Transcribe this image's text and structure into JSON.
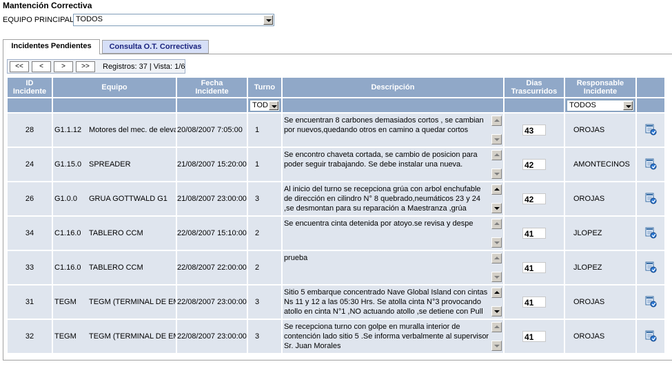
{
  "header": {
    "title": "Mantención Correctiva"
  },
  "filter": {
    "label": "EQUIPO PRINCIPAL :",
    "value": "TODOS"
  },
  "tabs": [
    {
      "label": "Incidentes Pendientes"
    },
    {
      "label": "Consulta O.T. Correctivas"
    }
  ],
  "pager": {
    "first": "<<",
    "prev": "<",
    "next": ">",
    "last": ">>",
    "status": "Registros: 37 | Vista: 1/6"
  },
  "columns": {
    "id": [
      "ID",
      "Incidente"
    ],
    "equipo": "Equipo",
    "fecha": [
      "Fecha",
      "Incidente"
    ],
    "turno": "Turno",
    "descripcion": "Descripción",
    "dias": [
      "Dias",
      "Trascurridos"
    ],
    "responsable": [
      "Responsable",
      "Incidente"
    ]
  },
  "filters": {
    "turno": "TOD",
    "responsable": "TODOS"
  },
  "rows": [
    {
      "id": "28",
      "code": "G1.1.12",
      "name": "Motores del mec. de eleva",
      "fecha": "20/08/2007 7:05:00",
      "turno": "1",
      "desc": "Se encuentran 8 carbones demasiados cortos , se cambian por nuevos,quedando otros en camino a quedar cortos",
      "dias": "43",
      "resp": "OROJAS"
    },
    {
      "id": "24",
      "code": "G1.15.0",
      "name": "SPREADER",
      "fecha": "21/08/2007 15:20:00",
      "turno": "1",
      "desc": "Se encontro chaveta cortada, se cambio de posicion para poder seguir trabajando. Se debe instalar una nueva.",
      "dias": "42",
      "resp": "AMONTECINOS"
    },
    {
      "id": "26",
      "code": "G1.0.0",
      "name": "GRUA GOTTWALD G1",
      "fecha": "21/08/2007 23:00:00",
      "turno": "3",
      "desc": "Al inicio del turno se recepciona grúa con arbol enchufable de dirección en cilindro N° 8 quebrado,neumáticos 23 y 24 ,se desmontan  para su reparación a Maestranza ,grúa",
      "dias": "42",
      "resp": "OROJAS"
    },
    {
      "id": "34",
      "code": "C1.16.0",
      "name": "TABLERO CCM",
      "fecha": "22/08/2007 15:10:00",
      "turno": "2",
      "desc": "Se encuentra cinta detenida por atoyo.se revisa y despe",
      "dias": "41",
      "resp": "JLOPEZ"
    },
    {
      "id": "33",
      "code": "C1.16.0",
      "name": "TABLERO CCM",
      "fecha": "22/08/2007 22:00:00",
      "turno": "2",
      "desc": "prueba",
      "dias": "41",
      "resp": "JLOPEZ"
    },
    {
      "id": "31",
      "code": "TEGM",
      "name": "TEGM (TERMINAL DE EMB",
      "fecha": "22/08/2007 23:00:00",
      "turno": "3",
      "desc": "Sitio 5 embarque concentrado Nave Global Island con cintas Ns 11 y 12 a las 05:30 Hrs. Se atolla cinta N°3 provocando atollo en cinta N°1 ,NO actuando atollo ,se detiene con Pull",
      "dias": "41",
      "resp": "OROJAS"
    },
    {
      "id": "32",
      "code": "TEGM",
      "name": "TEGM (TERMINAL DE EMB",
      "fecha": "22/08/2007 23:00:00",
      "turno": "3",
      "desc": "Se recepciona turno con golpe en muralla interior de contención lado sitio 5 .Se informa verbalmente al supervisor Sr. Juan Morales",
      "dias": "41",
      "resp": "OROJAS"
    }
  ]
}
